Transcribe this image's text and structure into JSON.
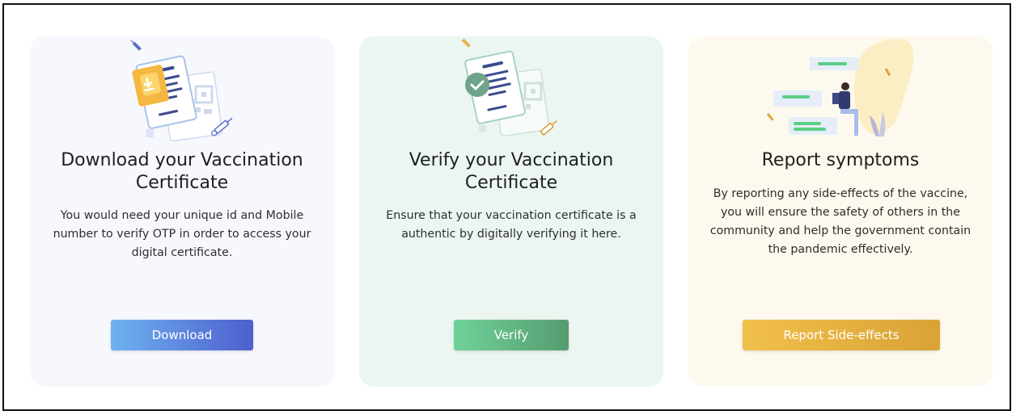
{
  "cards": [
    {
      "title": "Download your Vaccination Certificate",
      "description": "You would need your unique id and Mobile number to verify OTP in order to access your digital certificate.",
      "button_label": "Download",
      "illustration": "certificate-download-icon",
      "accent_color": "#4d5fce"
    },
    {
      "title": "Verify your Vaccination Certificate",
      "description": "Ensure that your vaccination certificate is a authentic by digitally verifying it here.",
      "button_label": "Verify",
      "illustration": "certificate-verified-icon",
      "accent_color": "#569c70"
    },
    {
      "title": "Report symptoms",
      "description": "By reporting any side-effects of the vaccine, you will ensure the safety of others in the community and help the government contain the pandemic effectively.",
      "button_label": "Report Side-effects",
      "illustration": "report-symptoms-illustration",
      "accent_color": "#d9a236"
    }
  ]
}
